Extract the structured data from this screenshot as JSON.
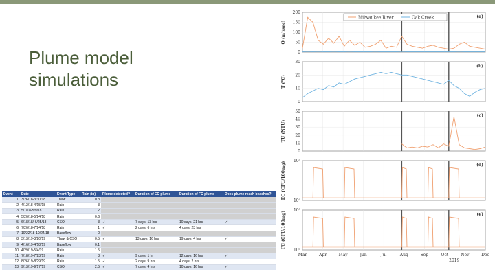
{
  "slide": {
    "title_line1": "Plume model",
    "title_line2": "simulations",
    "accent_color": "#8a9878",
    "title_color": "#4b5e3a"
  },
  "table": {
    "header_color": "#2f5496",
    "columns": [
      "Event",
      "Date",
      "Event Type",
      "Rain (in)",
      "Plume detected?",
      "Duration of EC plume",
      "Duration of FC plume",
      "Does plume reach beaches?"
    ],
    "rows": [
      {
        "event": "1",
        "date": "3/26/18-3/30/18",
        "type": "Thaw",
        "rain": "0.3",
        "detected": "",
        "ec": "",
        "fc": "",
        "beach": ""
      },
      {
        "event": "2",
        "date": "4/12/18-4/15/18",
        "type": "Rain",
        "rain": "3",
        "detected": "",
        "ec": "",
        "fc": "",
        "beach": ""
      },
      {
        "event": "3",
        "date": "5/1/18-5/9/18",
        "type": "Rain",
        "rain": "1.2",
        "detected": "",
        "ec": "",
        "fc": "",
        "beach": ""
      },
      {
        "event": "4",
        "date": "5/20/18-5/24/18",
        "type": "Rain",
        "rain": "0.6",
        "detected": "",
        "ec": "",
        "fc": "",
        "beach": ""
      },
      {
        "event": "5",
        "date": "6/18/18/-6/25/18",
        "type": "CSO",
        "rain": "3",
        "detected": "✓",
        "ec": "7 days, 13 hrs",
        "fc": "10 days, 21 hrs",
        "beach": "✓"
      },
      {
        "event": "6",
        "date": "7/20/18-7/24/18",
        "type": "Rain",
        "rain": "1",
        "detected": "✓",
        "ec": "2 days, 6 hrs",
        "fc": "4 days, 23 hrs",
        "beach": ""
      },
      {
        "event": "7",
        "date": "10/22/18-10/24/18",
        "type": "Baseflow",
        "rain": "0",
        "detected": "",
        "ec": "",
        "fc": "",
        "beach": ""
      },
      {
        "event": "8",
        "date": "3/13/19-3/20/19",
        "type": "Thaw & CSO",
        "rain": "0.5",
        "detected": "✓",
        "ec": "13 days, 16 hrs",
        "fc": "19 days, 4 hrs",
        "beach": "✓"
      },
      {
        "event": "9",
        "date": "4/16/19-4/18/19",
        "type": "Baseflow",
        "rain": "0.1",
        "detected": "",
        "ec": "",
        "fc": "",
        "beach": ""
      },
      {
        "event": "10",
        "date": "4/29/19-5/4/19",
        "type": "Rain",
        "rain": "1.5",
        "detected": "",
        "ec": "",
        "fc": "",
        "beach": ""
      },
      {
        "event": "11",
        "date": "7/18/19-7/23/19",
        "type": "Rain",
        "rain": "3",
        "detected": "✓",
        "ec": "9 days, 1 hr",
        "fc": "12 days, 16 hrs",
        "beach": "✓"
      },
      {
        "event": "12",
        "date": "8/26/19-8/29/19",
        "type": "Rain",
        "rain": "1.5",
        "detected": "✓",
        "ec": "2 days, 9 hrs",
        "fc": "4 days, 2 hrs",
        "beach": ""
      },
      {
        "event": "13",
        "date": "9/13/19-9/17/19",
        "type": "CSO",
        "rain": "2.5",
        "detected": "✓",
        "ec": "7 days, 4 hrs",
        "fc": "10 days, 16 hrs",
        "beach": "✓"
      }
    ]
  },
  "chart_data": [
    {
      "type": "line",
      "panel_label": "(a)",
      "ylabel": "Q (m³/sec)",
      "ylim": [
        0,
        200
      ],
      "yticks": [
        "0",
        "50",
        "100",
        "150",
        "200"
      ],
      "legend": [
        "Milwaukee River",
        "Oak Creek"
      ],
      "legend_placement": "top",
      "grid": true,
      "series": [
        {
          "name": "Milwaukee River",
          "color": "#f0a070",
          "values": [
            20,
            175,
            150,
            60,
            40,
            70,
            45,
            80,
            30,
            60,
            35,
            50,
            25,
            30,
            40,
            60,
            20,
            30,
            25,
            80,
            40,
            30,
            25,
            20,
            30,
            35,
            25,
            20,
            15,
            20,
            40,
            50,
            30,
            25,
            20,
            15
          ]
        },
        {
          "name": "Oak Creek",
          "color": "#6fb3e0",
          "values": [
            2,
            3,
            2,
            3,
            2,
            2,
            3,
            2,
            2,
            3,
            2,
            2,
            2,
            2,
            3,
            2,
            2,
            2,
            2,
            3,
            2,
            2,
            2,
            2,
            2,
            2,
            2,
            2,
            2,
            2,
            3,
            2,
            2,
            2,
            2,
            2
          ]
        }
      ]
    },
    {
      "type": "line",
      "panel_label": "(b)",
      "ylabel": "T (°C)",
      "ylim": [
        0,
        30
      ],
      "yticks": [
        "0",
        "10",
        "20",
        "30"
      ],
      "grid": true,
      "series": [
        {
          "color": "#6fb3e0",
          "values": [
            3,
            6,
            8,
            10,
            9,
            12,
            11,
            14,
            13,
            15,
            17,
            18,
            19,
            20,
            21,
            22,
            21,
            22,
            21,
            20,
            20,
            19,
            18,
            17,
            16,
            15,
            14,
            13,
            16,
            12,
            10,
            6,
            4,
            7,
            9,
            10
          ]
        }
      ]
    },
    {
      "type": "line",
      "panel_label": "(c)",
      "ylabel": "TU (NTU)",
      "ylim": [
        0,
        50
      ],
      "yticks": [
        "0",
        "10",
        "20",
        "30",
        "40",
        "50"
      ],
      "grid": true,
      "series": [
        {
          "color": "#f0a070",
          "start_index": 19,
          "values": [
            9,
            4,
            5,
            4,
            6,
            5,
            8,
            4,
            9,
            6,
            43,
            8,
            4,
            3,
            2,
            3,
            5
          ]
        }
      ]
    },
    {
      "type": "line",
      "panel_label": "(d)",
      "ylabel": "EC (CFU/100mg)",
      "yscale": "log",
      "yticks": [
        "10⁰",
        "10⁵"
      ],
      "grid": true,
      "peaks": [
        [
          2,
          4
        ],
        [
          8,
          10
        ],
        [
          19,
          20
        ],
        [
          24,
          25
        ],
        [
          28,
          30
        ]
      ]
    },
    {
      "type": "line",
      "panel_label": "(e)",
      "ylabel": "FC (CFU/100mg)",
      "yscale": "log",
      "yticks": [
        "10⁰",
        "10⁵"
      ],
      "grid": true,
      "peaks": [
        [
          2,
          4
        ],
        [
          8,
          10
        ],
        [
          19,
          20
        ],
        [
          24,
          25
        ],
        [
          28,
          30
        ]
      ]
    }
  ],
  "x_axis": {
    "ticks": [
      "Mar",
      "Apr",
      "May",
      "Jun",
      "Jul",
      "Aug",
      "Sep",
      "Oct",
      "Nov",
      "Dec"
    ],
    "year_label": "2019",
    "event_lines_at_index": [
      19,
      28
    ]
  }
}
